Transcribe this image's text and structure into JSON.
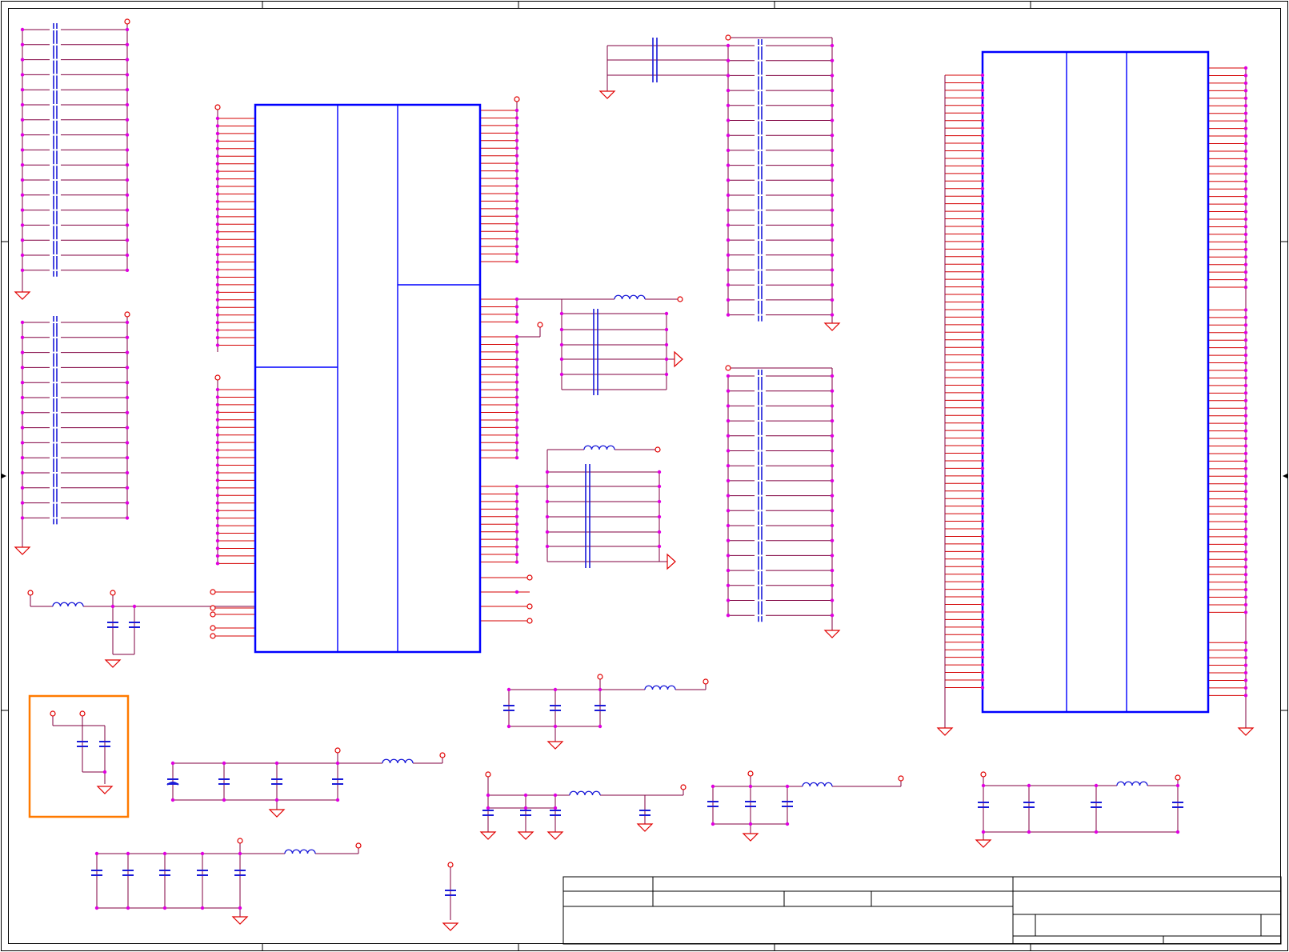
{
  "document": {
    "kind": "schematic-sheet",
    "text_labels": []
  },
  "colors": {
    "background": "#ffffff",
    "frame": "#000000",
    "wire": "#800040",
    "pin": "#d40000",
    "junction": "#e000e0",
    "capacitor": "#1a1ad8",
    "inductor": "#1a1ad8",
    "ic_body": "#0000ff",
    "power_port": "#e00000",
    "ground": "#e00000",
    "highlight_box": "#ff7a00",
    "title_block": "#000000"
  },
  "icons": {
    "ground": "ground-symbol-icon",
    "power": "power-port-icon",
    "capacitor": "capacitor-icon",
    "inductor": "inductor-icon",
    "junction": "junction-dot-icon",
    "offsheet": "offsheet-arrow-icon"
  }
}
